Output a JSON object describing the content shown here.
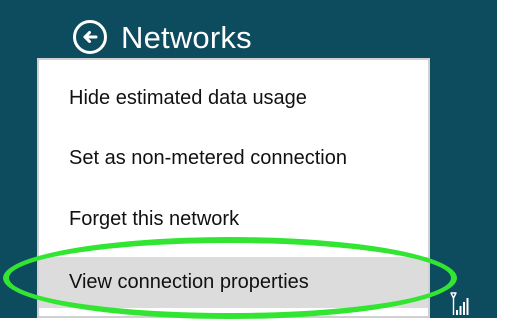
{
  "header": {
    "title": "Networks",
    "back_icon": "back-arrow-icon"
  },
  "menu": {
    "items": [
      {
        "label": "Hide estimated data usage"
      },
      {
        "label": "Set as non-metered connection"
      },
      {
        "label": "Forget this network"
      },
      {
        "label": "View connection properties"
      }
    ]
  },
  "status": {
    "signal_icon": "wifi-signal-icon"
  },
  "colors": {
    "panel": "#0d4b5f",
    "highlight": "#32e532",
    "selected_item": "#dcdcdc"
  }
}
